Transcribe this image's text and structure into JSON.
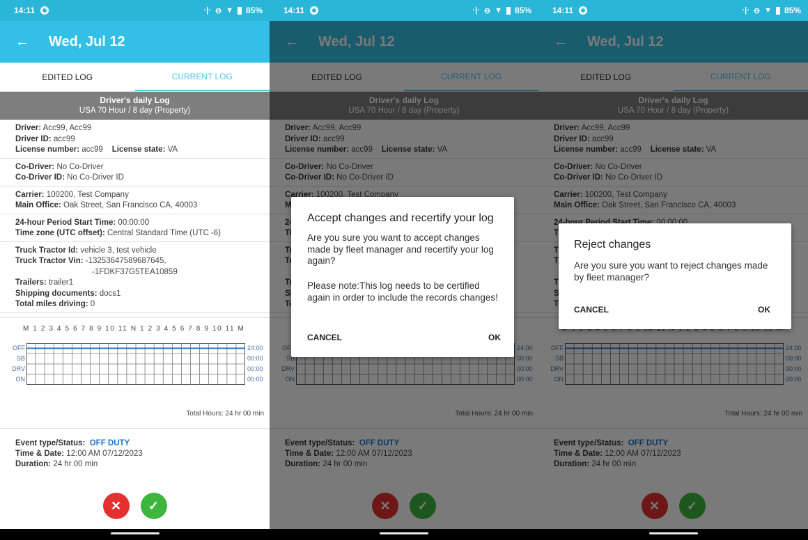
{
  "status_bar": {
    "time": "14:11",
    "battery": "85%"
  },
  "app_bar": {
    "title": "Wed, Jul 12"
  },
  "tabs": [
    {
      "label": "EDITED LOG"
    },
    {
      "label": "CURRENT LOG"
    }
  ],
  "log_header": {
    "title": "Driver's daily Log",
    "subtitle": "USA 70 Hour / 8 day (Property)"
  },
  "info": {
    "driver_label": "Driver:",
    "driver": "Acc99, Acc99",
    "driver_id_label": "Driver ID:",
    "driver_id": "acc99",
    "license_number_label": "License number:",
    "license_number": "acc99",
    "license_state_label": "License state:",
    "license_state": "VA",
    "co_driver_label": "Co-Driver:",
    "co_driver": "No Co-Driver",
    "co_driver_id_label": "Co-Driver ID:",
    "co_driver_id": "No Co-Driver ID",
    "carrier_label": "Carrier:",
    "carrier": "100200, Test Company",
    "main_office_label": "Main Office:",
    "main_office": "Oak Street, San Francisco CA, 40003",
    "period_start_label": "24-hour Period Start Time:",
    "period_start": "00:00:00",
    "timezone_label": "Time zone (UTC offset):",
    "timezone": "Central Standard Time (UTC -6)",
    "truck_id_label": "Truck Tractor Id:",
    "truck_id": "vehicle 3, test vehicle",
    "truck_vin_label": "Truck Tractor Vin:",
    "truck_vin_1": "-13253647589687645,",
    "truck_vin_2": "-1FDKF37G5TEA10859",
    "trailers_label": "Trailers:",
    "trailers": "trailer1",
    "shipping_label": "Shipping documents:",
    "shipping": "docs1",
    "miles_label": "Total miles driving:",
    "miles": "0"
  },
  "graph": {
    "hours_header": "M 1 2 3 4 5 6 7 8 9 10 11 N 1 2 3 4 5 6 7 8 9 10 11 M",
    "rows": [
      {
        "label": "OFF",
        "total": "24:00"
      },
      {
        "label": "SB",
        "total": "00:00"
      },
      {
        "label": "DRV",
        "total": "00:00"
      },
      {
        "label": "ON",
        "total": "00:00"
      }
    ],
    "total_hours": "Total Hours: 24 hr 00 min"
  },
  "event": {
    "status_label": "Event type/Status:",
    "status": "OFF DUTY",
    "time_label": "Time & Date:",
    "time": "12:00 AM 07/12/2023",
    "duration_label": "Duration:",
    "duration": "24 hr 00 min"
  },
  "dialog_accept": {
    "title": "Accept changes and recertify your log",
    "body": "Are you sure you want to accept changes made by fleet manager and recertify your log again?",
    "note": "Please note:This log needs to be certified again in order to include the records changes!",
    "cancel": "CANCEL",
    "ok": "OK"
  },
  "dialog_reject": {
    "title": "Reject changes",
    "body": "Are you sure you want to reject changes made by fleet manager?",
    "cancel": "CANCEL",
    "ok": "OK"
  },
  "colors": {
    "status_bar": "#29b6d8",
    "app_bar": "#34c0e6",
    "accent": "#4fc3e8",
    "reject": "#e53030",
    "accept": "#3db63d",
    "off_duty": "#1f73c9"
  }
}
